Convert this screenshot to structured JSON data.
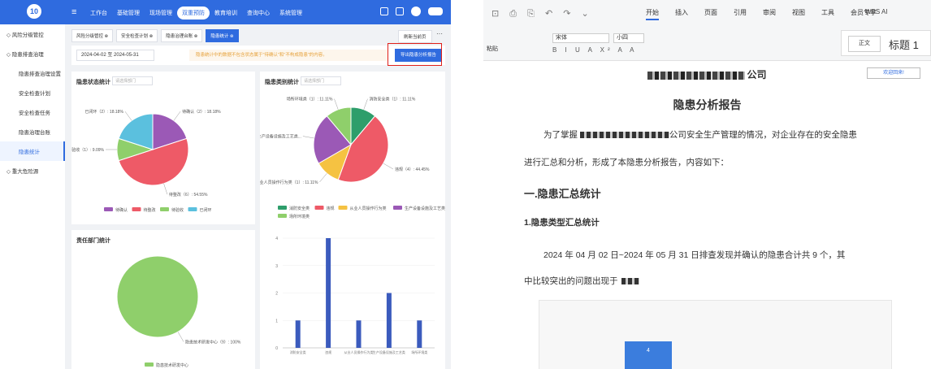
{
  "left": {
    "logo": "10",
    "nav": [
      "工作台",
      "基础管理",
      "现场管理",
      "双重预防",
      "教育培训",
      "查询中心",
      "系统管理"
    ],
    "nav_active": "双重预防",
    "sidebar": [
      {
        "label": "风险分级管控",
        "sub": false
      },
      {
        "label": "隐患排查治理",
        "sub": false
      },
      {
        "label": "隐患排查治理设置",
        "sub": true
      },
      {
        "label": "安全检查计划",
        "sub": true
      },
      {
        "label": "安全检查任务",
        "sub": true
      },
      {
        "label": "隐患治理台账",
        "sub": true
      },
      {
        "label": "隐患统计",
        "sub": true,
        "active": true
      },
      {
        "label": "重大危险源",
        "sub": false
      }
    ],
    "tags": [
      "风险分级管控",
      "安全检查计划",
      "隐患治理台账",
      "隐患统计"
    ],
    "refresh": "刷新当前页",
    "date_range": "2024-04-02  至  2024-05-31",
    "notice": "隐患统计中的数据不包含状态属于\"待确认\"和\"不构成隐患\"的内容。",
    "export_btn": "导出隐患分析报告",
    "status_card": {
      "title": "隐患状态统计",
      "select": "请选择部门"
    },
    "type_card": {
      "title": "隐患类别统计",
      "select": "请选择部门"
    },
    "dept_card": {
      "title": "责任部门统计"
    }
  },
  "chart_data": [
    {
      "type": "pie",
      "title": "隐患状态统计",
      "categories": [
        "待确认",
        "待整改",
        "待验收",
        "已闭环"
      ],
      "values": [
        2,
        5,
        1,
        2
      ],
      "labels": [
        "待确认（2）: 18.18%",
        "待整改（6）: 54.55%",
        "待验收（1）: 9.09%",
        "已闭环（2）: 18.18%"
      ],
      "colors": [
        "#9b59b6",
        "#ee5a67",
        "#8fcf6b",
        "#5bc0de"
      ],
      "legend": "bottom"
    },
    {
      "type": "pie",
      "title": "隐患类别统计",
      "categories": [
        "消防安全类",
        "违规",
        "从业人员操作行为类",
        "生产设备设施及工艺类",
        "场所环境类"
      ],
      "values": [
        1,
        4,
        1,
        2,
        1
      ],
      "labels": [
        "消防安全类（1）: 11.11%",
        "违规（4）: 44.45%",
        "从业人员操作行为类（1）: 11.11%",
        "生产设备设施及工艺类...",
        "场所环境类（1）: 11.11%"
      ],
      "colors": [
        "#2e9e6b",
        "#ee5a67",
        "#f5c242",
        "#9b59b6",
        "#8fcf6b"
      ],
      "legend": "bottom"
    },
    {
      "type": "pie",
      "title": "责任部门统计",
      "categories": [
        "隐患技术研发中心"
      ],
      "values": [
        9
      ],
      "labels": [
        "隐患技术研发中心（9）: 100%"
      ],
      "colors": [
        "#8fcf6b"
      ],
      "legend": "bottom"
    },
    {
      "type": "bar",
      "categories": [
        "消防安全类",
        "违规",
        "从业人员操作行为类",
        "生产设备设施及工艺类",
        "场所环境类"
      ],
      "values": [
        1,
        4,
        1,
        2,
        1
      ],
      "ylim": [
        0,
        4
      ],
      "color": "#3b5bbd"
    }
  ],
  "right": {
    "quick_icons": "⊡ ⎙ ⎘ ↶ ↷ ⌄",
    "ribbon_tabs": [
      "开始",
      "插入",
      "页面",
      "引用",
      "审阅",
      "视图",
      "工具",
      "会员专享"
    ],
    "ribbon_active": "开始",
    "wps_ai": "WPS AI",
    "font_name": "宋体",
    "font_size": "小四",
    "paste": "粘贴",
    "fmt_glyphs": "B I U A X² A A",
    "style_normal": "正文",
    "style_h1": "标题 1",
    "company_suffix": "公司",
    "welcome": "欢迎回来!",
    "report_title": "隐患分析报告",
    "p1a": "为了掌握",
    "p1b": "公司安全生产管理的情况，对企业存在的安全隐患",
    "p2": "进行汇总和分析，形成了本隐患分析报告，内容如下：",
    "h1": "一.隐患汇总统计",
    "h2": "1.隐患类型汇总统计",
    "p3": "2024 年 04 月 02 日~2024 年 05 月 31 日排查发现并确认的隐患合计共 9 个，其",
    "p4": "中比较突出的问题出现于",
    "emb_bar_label": "4"
  }
}
